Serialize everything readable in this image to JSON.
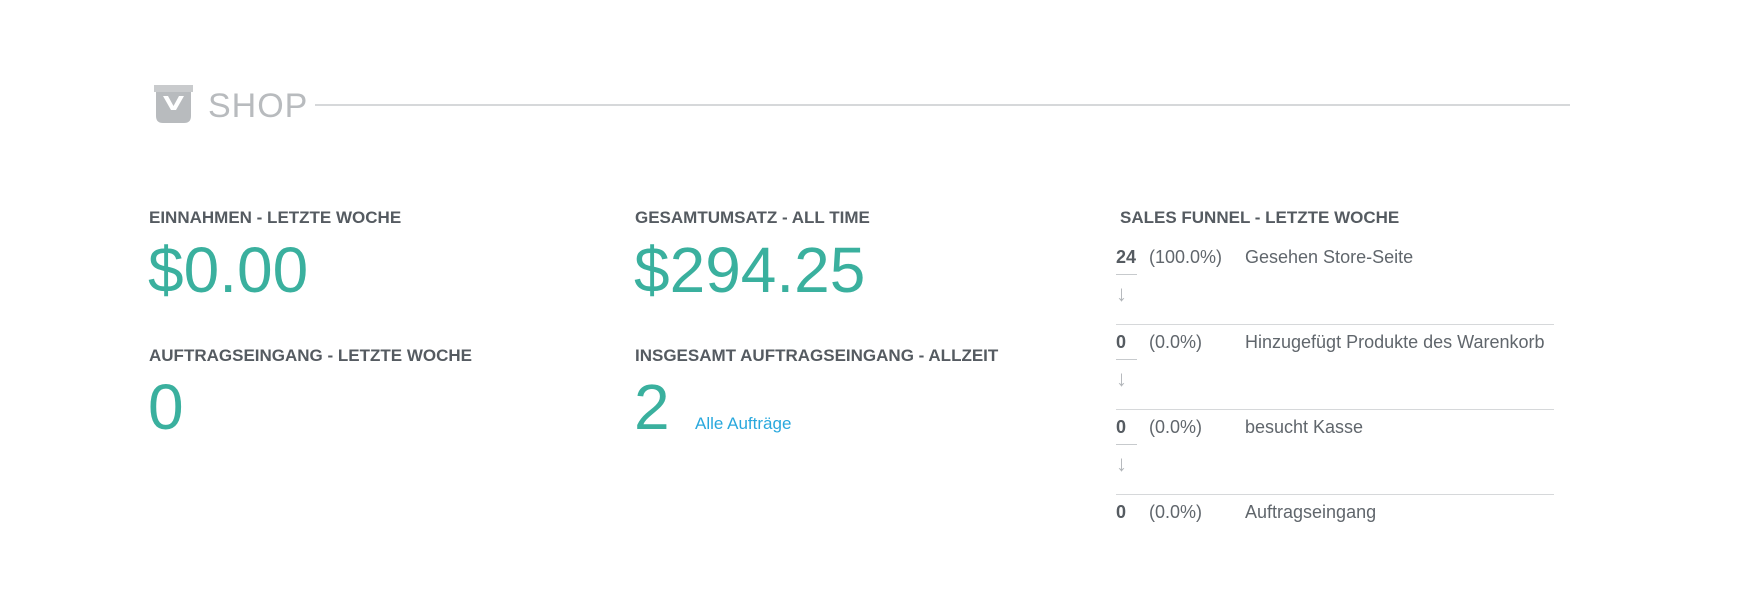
{
  "section": {
    "title": "SHOP",
    "icon": "shopping-bag-icon"
  },
  "stats": {
    "revenue_week": {
      "label": "EINNAHMEN - LETZTE WOCHE",
      "value": "$0.00"
    },
    "revenue_total": {
      "label": "GESAMTUMSATZ - ALL TIME",
      "value": "$294.25"
    },
    "orders_week": {
      "label": "AUFTRAGSEINGANG - LETZTE WOCHE",
      "value": "0"
    },
    "orders_total": {
      "label": "INSGESAMT AUFTRAGSEINGANG - ALLZEIT",
      "value": "2",
      "link_label": "Alle Aufträge"
    }
  },
  "funnel": {
    "title": "SALES FUNNEL - LETZTE WOCHE",
    "arrow": "↓",
    "steps": [
      {
        "count": "24",
        "percent": "(100.0%)",
        "label": "Gesehen Store-Seite"
      },
      {
        "count": "0",
        "percent": "(0.0%)",
        "label": "Hinzugefügt Produkte des Warenkorb"
      },
      {
        "count": "0",
        "percent": "(0.0%)",
        "label": "besucht Kasse"
      },
      {
        "count": "0",
        "percent": "(0.0%)",
        "label": "Auftragseingang"
      }
    ]
  },
  "colors": {
    "accent": "#3ab09e",
    "link": "#29a8dd",
    "label": "#555b61",
    "muted": "#b8bbbe"
  }
}
